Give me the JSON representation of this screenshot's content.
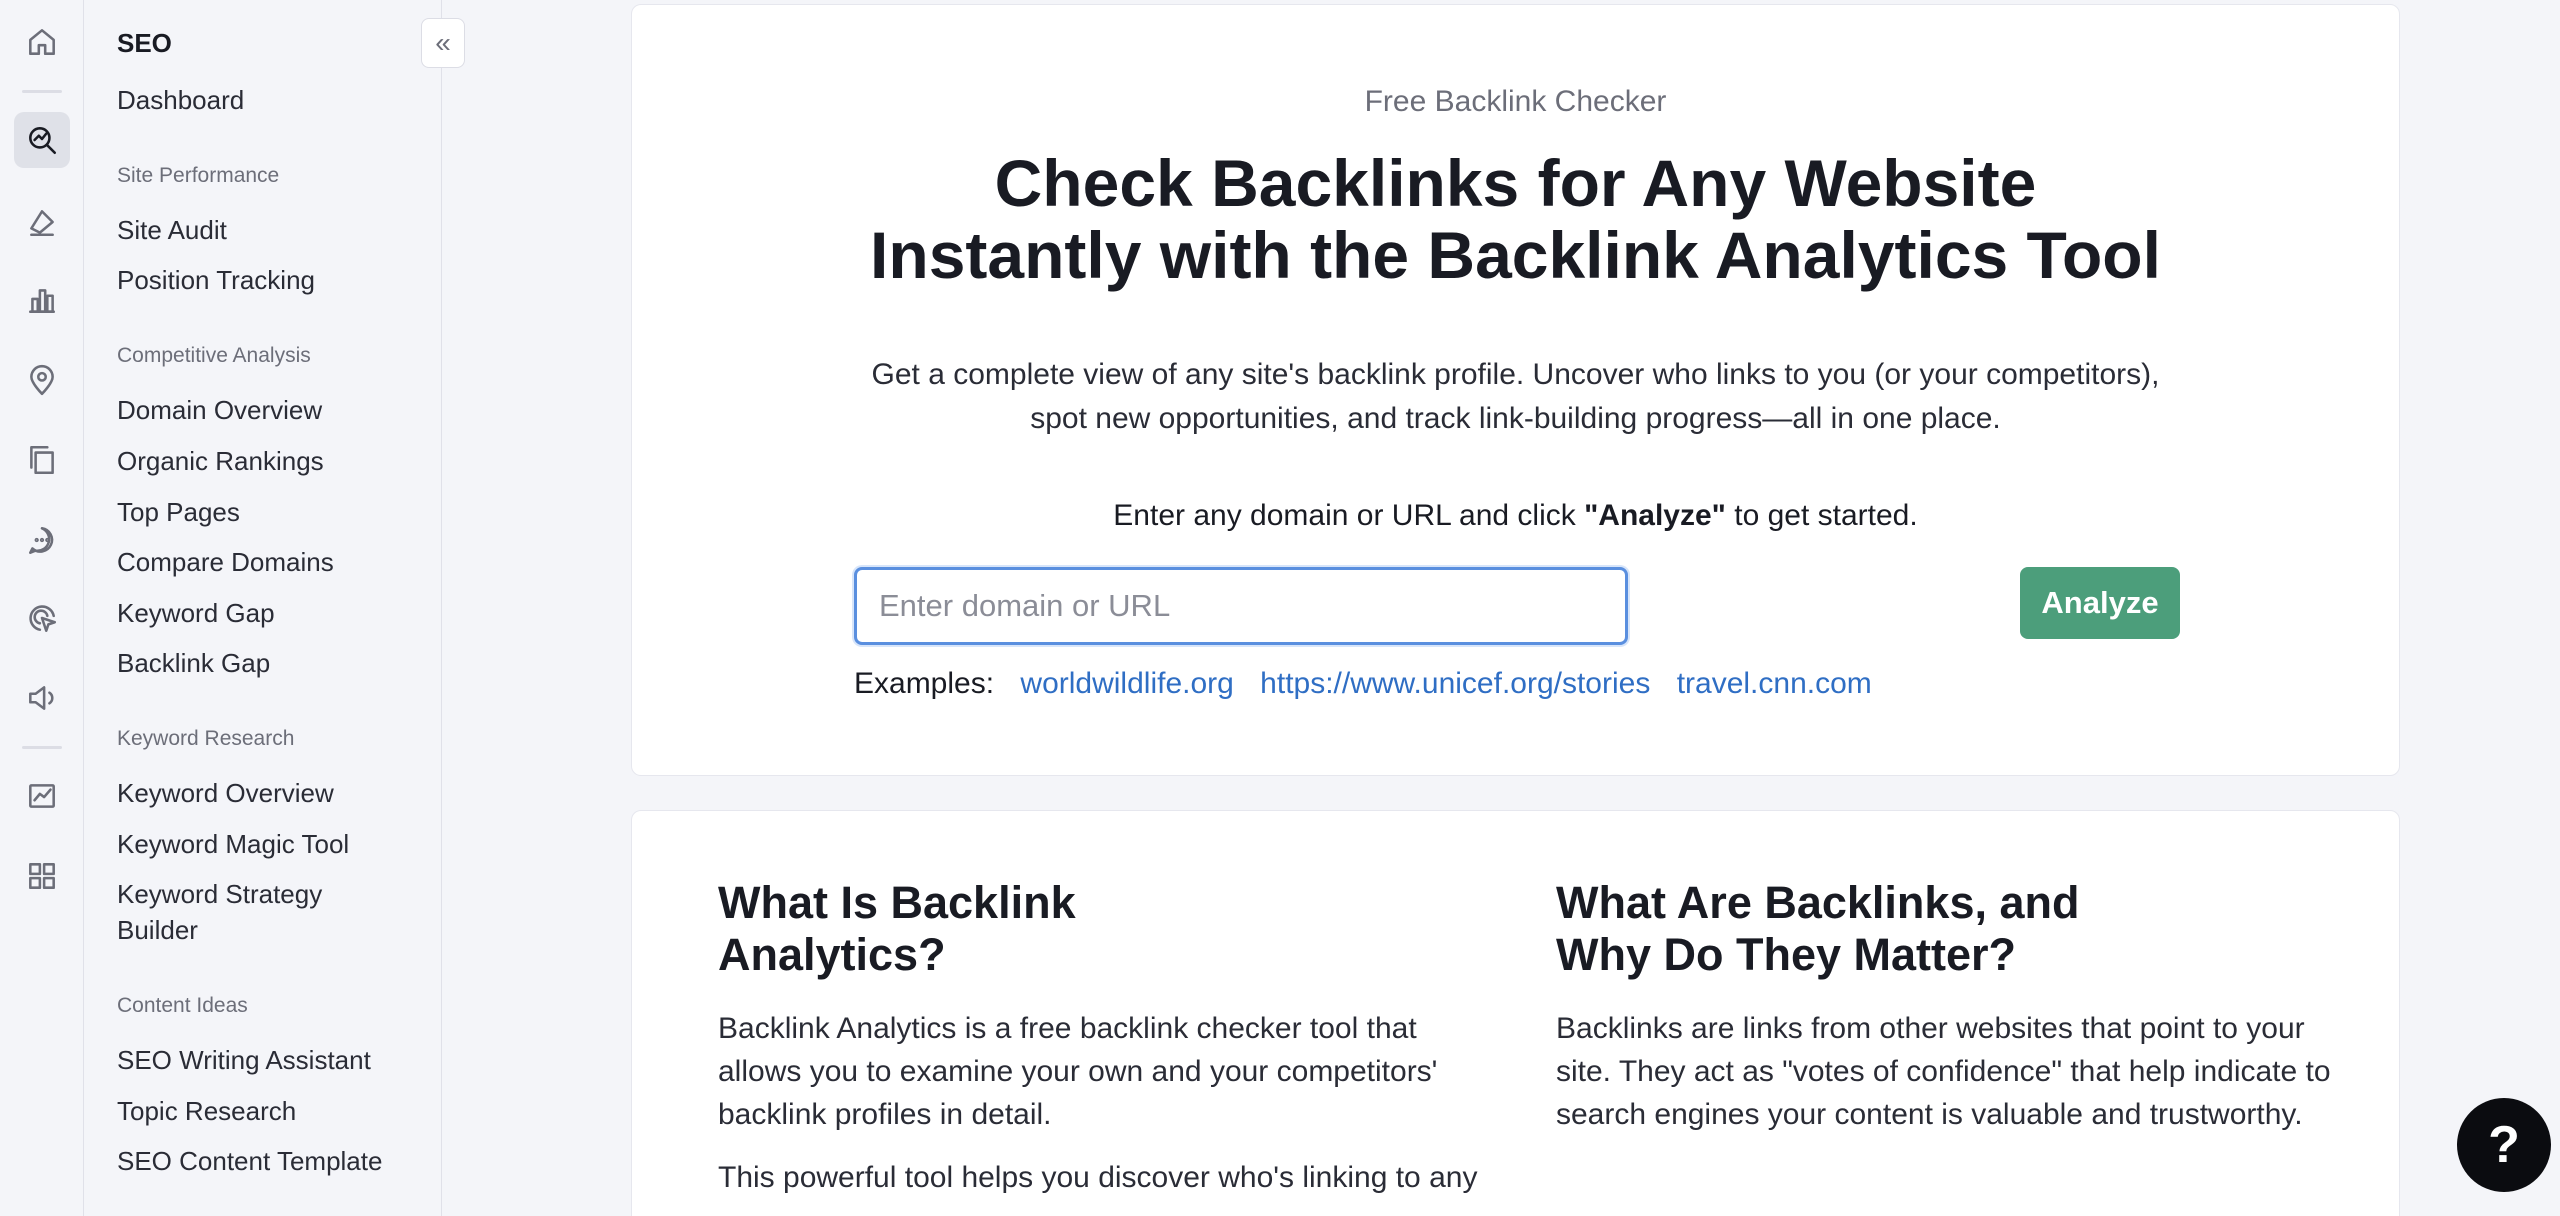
{
  "rail": {
    "icons": [
      "home-icon",
      "seo-icon",
      "advertising-icon",
      "analytics-icon",
      "local-icon",
      "content-icon",
      "social-icon",
      "ai-icon",
      "pr-icon",
      "reports-icon",
      "apps-icon"
    ]
  },
  "sidebar": {
    "title": "SEO",
    "dashboard": "Dashboard",
    "sections": [
      {
        "heading": "Site Performance",
        "items": [
          "Site Audit",
          "Position Tracking"
        ]
      },
      {
        "heading": "Competitive Analysis",
        "items": [
          "Domain Overview",
          "Organic Rankings",
          "Top Pages",
          "Compare Domains",
          "Keyword Gap",
          "Backlink Gap"
        ]
      },
      {
        "heading": "Keyword Research",
        "items": [
          "Keyword Overview",
          "Keyword Magic Tool",
          "Keyword Strategy",
          "Builder"
        ]
      },
      {
        "heading": "Content Ideas",
        "items": [
          "SEO Writing Assistant",
          "Topic Research",
          "SEO Content Template"
        ]
      }
    ],
    "collapse_label": "«"
  },
  "hero": {
    "eyebrow": "Free Backlink Checker",
    "title_line1": "Check Backlinks for Any Website",
    "title_line2": "Instantly with the Backlink Analytics Tool",
    "desc_line1": "Get a complete view of any site's backlink profile. Uncover who links to you (or your competitors),",
    "desc_line2": "spot new opportunities, and track link-building progress—all in one place.",
    "cta_prefix": "Enter any domain or URL and click ",
    "cta_bold": "\"Analyze\"",
    "cta_suffix": " to get started.",
    "input_placeholder": "Enter domain or URL",
    "input_value": "",
    "analyze_label": "Analyze",
    "examples_label": "Examples:",
    "examples": [
      "worldwildlife.org",
      "https://www.unicef.org/stories",
      "travel.cnn.com"
    ]
  },
  "info": {
    "left_title_line1": "What Is Backlink",
    "left_title_line2": "Analytics?",
    "left_p1": "Backlink Analytics is a free backlink checker tool that allows you to examine your own and your competitors' backlink profiles in detail.",
    "left_p2": "This powerful tool helps you discover who's linking to any",
    "right_title_line1": "What Are Backlinks, and",
    "right_title_line2": "Why Do They Matter?",
    "right_p1": "Backlinks are links from other websites that point to your site. They act as \"votes of confidence\" that help indicate to search engines your content is valuable and trustworthy."
  },
  "help": {
    "label": "?"
  }
}
